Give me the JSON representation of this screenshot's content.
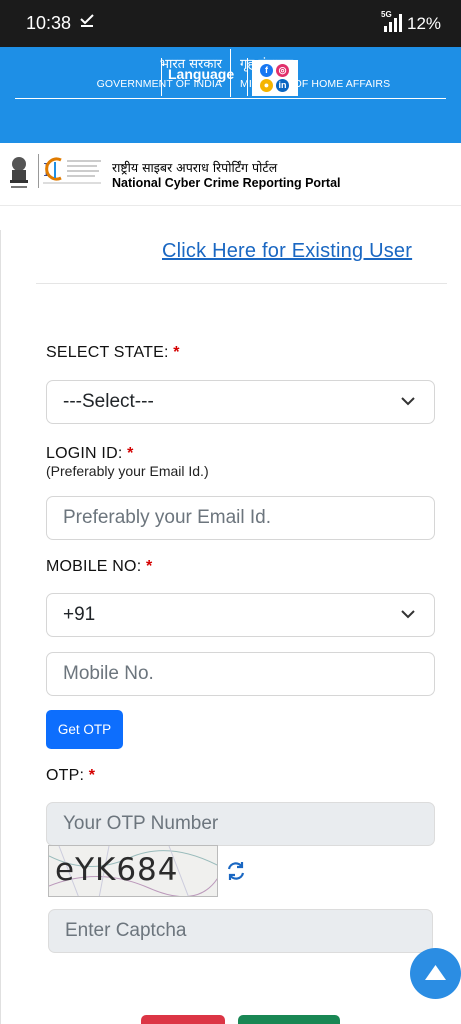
{
  "status_bar": {
    "time": "10:38",
    "download_icon": "download-done-icon",
    "network": "5G",
    "battery": "12%"
  },
  "gov_header": {
    "left_hindi": "भारत सरकार",
    "left_english": "GOVERNMENT OF INDIA",
    "right_hindi": "गृह मंत्रालय",
    "right_english": "MINISTRY OF HOME AFFAIRS",
    "language_label": "Language",
    "social": [
      "facebook-icon",
      "instagram-icon",
      "koo-icon",
      "linkedin-icon"
    ]
  },
  "portal": {
    "title_hindi": "राष्ट्रीय साइबर अपराध रिपोर्टिंग पोर्टल",
    "title_english": "National Cyber Crime Reporting Portal"
  },
  "form": {
    "existing_user_link": "Click Here for Existing User",
    "state_label": "SELECT STATE:",
    "state_value": "---Select---",
    "login_label": "LOGIN ID:",
    "login_hint": "(Preferably your Email Id.)",
    "login_placeholder": "Preferably your Email Id.",
    "mobile_label": "MOBILE NO:",
    "country_code": "+91",
    "mobile_placeholder": "Mobile No.",
    "get_otp_label": "Get OTP",
    "otp_label": "OTP:",
    "otp_placeholder": "Your OTP Number",
    "captcha_text": "eYK684",
    "captcha_placeholder": "Enter Captcha",
    "required_mark": "*"
  },
  "colors": {
    "header_blue": "#1e8fe6",
    "link_blue": "#1a67c2",
    "button_blue": "#0d6efd",
    "required_red": "#d40000",
    "cancel_red": "#dc3545",
    "submit_green": "#198754"
  }
}
